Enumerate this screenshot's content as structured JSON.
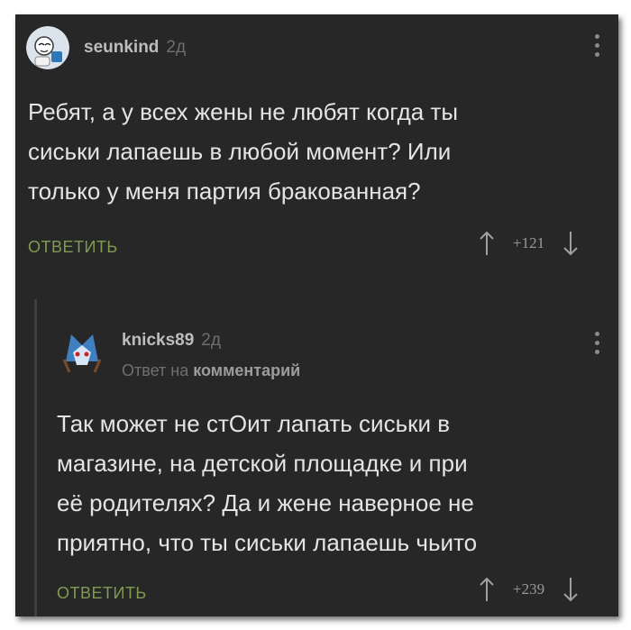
{
  "comment": {
    "username": "seunkind",
    "time": "2д",
    "text": "Ребят, а у всех жены не любят когда ты\nсиськи лапаешь в любой момент? Или\nтолько у меня партия бракованная?",
    "reply_label": "ОТВЕТИТЬ",
    "score": "+121"
  },
  "reply": {
    "username": "knicks89",
    "time": "2д",
    "reply_to_prefix": "Ответ на",
    "reply_to_target": "комментарий",
    "text": "Так может не стОит лапать сиськи в\nмагазине, на детской площадке и при\nеё родителях? Да и жене наверное не\nприятно, что ты сиськи лапаешь чьито",
    "reply_label": "ОТВЕТИТЬ",
    "score": "+239"
  },
  "colors": {
    "background": "#272727",
    "reply_link": "#7f9a52",
    "text": "#e4e4e4"
  },
  "icons": {
    "menu": "vertical-dots-icon",
    "upvote": "arrow-up-icon",
    "downvote": "arrow-down-icon"
  }
}
